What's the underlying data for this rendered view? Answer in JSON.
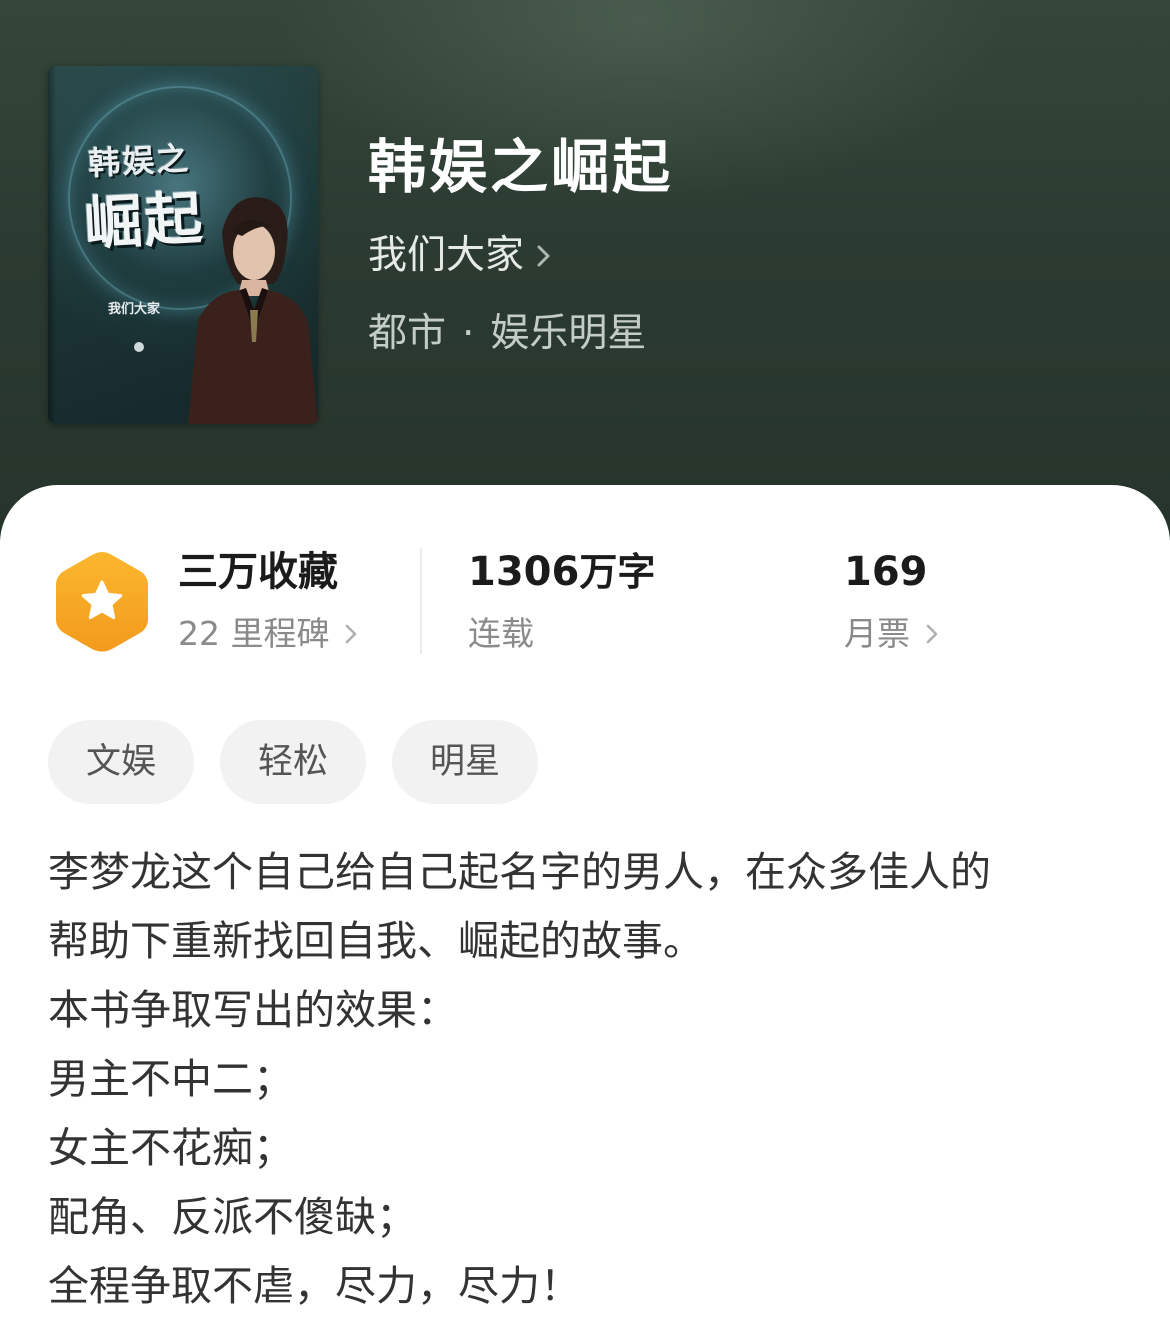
{
  "book": {
    "title": "韩娱之崛起",
    "author": "我们大家",
    "category": "都市",
    "separator": "·",
    "subcategory": "娱乐明星",
    "cover": {
      "title_line1": "韩娱之",
      "title_line2": "崛起",
      "author_text": "我们大家"
    }
  },
  "stats": {
    "favorites": {
      "value": "三万收藏",
      "sub": "22 里程碑"
    },
    "words": {
      "number": "1306",
      "unit": "万字",
      "sub": "连载"
    },
    "monthly_ticket": {
      "value": "169",
      "sub": "月票"
    }
  },
  "tags": [
    "文娱",
    "轻松",
    "明星"
  ],
  "synopsis": [
    "李梦龙这个自己给自己起名字的男人，在众多佳人的",
    "帮助下重新找回自我、崛起的故事。",
    "本书争取写出的效果：",
    "男主不中二；",
    "女主不花痴；",
    "配角、反派不傻缺；",
    "全程争取不虐，尽力，尽力！"
  ],
  "colors": {
    "header_bg": "#2c3b31",
    "badge_orange": "#f7a325",
    "text_primary": "#1b1b1b",
    "text_secondary": "#8a8a8a",
    "tag_bg": "#f2f2f2"
  },
  "icons": {
    "badge": "star-hexagon-icon",
    "chevron": "chevron-right-icon"
  }
}
